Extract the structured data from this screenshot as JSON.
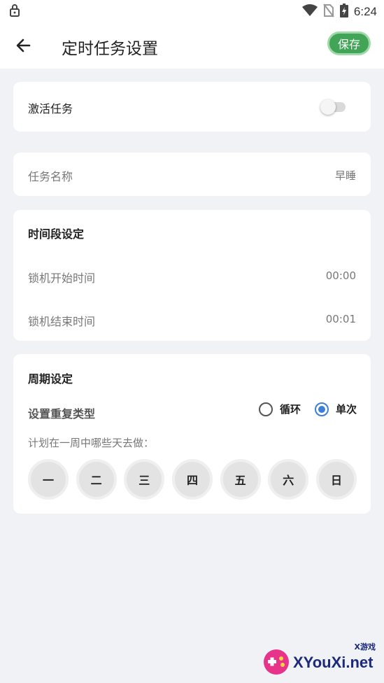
{
  "status_bar": {
    "time": "6:24"
  },
  "header": {
    "title": "定时任务设置",
    "save_label": "保存"
  },
  "activate": {
    "label": "激活任务",
    "enabled": false
  },
  "task_name": {
    "label": "任务名称",
    "value": "早睡"
  },
  "time_section": {
    "title": "时间段设定",
    "start": {
      "label": "锁机开始时间",
      "value": "00:00"
    },
    "end": {
      "label": "锁机结束时间",
      "value": "00:01"
    }
  },
  "cycle_section": {
    "title": "周期设定",
    "repeat_label": "设置重复类型",
    "options": [
      {
        "label": "循环",
        "selected": false
      },
      {
        "label": "单次",
        "selected": true
      }
    ],
    "days_prompt": "计划在一周中哪些天去做：",
    "days": [
      "一",
      "二",
      "三",
      "四",
      "五",
      "六",
      "日"
    ]
  },
  "watermark": {
    "text": "XYouXi.net",
    "small": "X游戏"
  },
  "colors": {
    "accent_green": "#41a456",
    "radio_blue": "#3d7fd6",
    "background": "#f0f2f5"
  }
}
